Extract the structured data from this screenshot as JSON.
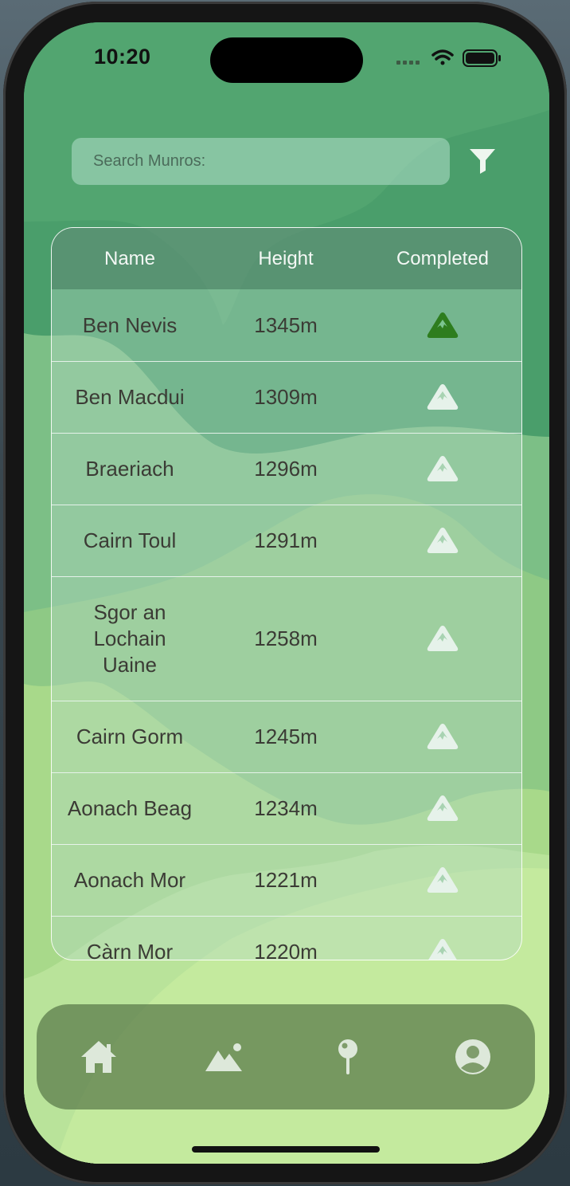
{
  "status_bar": {
    "time": "10:20",
    "signal_icon": "signal-dots-icon",
    "wifi_icon": "wifi-icon",
    "battery_icon": "battery-icon"
  },
  "search": {
    "placeholder": "Search Munros:",
    "value": "",
    "filter_icon": "filter-icon"
  },
  "table": {
    "headers": {
      "name": "Name",
      "height": "Height",
      "completed": "Completed"
    },
    "rows": [
      {
        "name": "Ben Nevis",
        "height": "1345m",
        "completed": true
      },
      {
        "name": "Ben Macdui",
        "height": "1309m",
        "completed": false
      },
      {
        "name": "Braeriach",
        "height": "1296m",
        "completed": false
      },
      {
        "name": "Cairn Toul",
        "height": "1291m",
        "completed": false
      },
      {
        "name": "Sgor an Lochain Uaine",
        "height": "1258m",
        "completed": false
      },
      {
        "name": "Cairn Gorm",
        "height": "1245m",
        "completed": false
      },
      {
        "name": "Aonach Beag",
        "height": "1234m",
        "completed": false
      },
      {
        "name": "Aonach Mor",
        "height": "1221m",
        "completed": false
      },
      {
        "name": "Càrn Mor",
        "height": "1220m",
        "completed": false
      }
    ]
  },
  "nav": [
    {
      "label": "home",
      "icon": "home-icon"
    },
    {
      "label": "mountains",
      "icon": "mountain-icon"
    },
    {
      "label": "map",
      "icon": "map-pin-icon"
    },
    {
      "label": "profile",
      "icon": "profile-icon"
    }
  ],
  "colors": {
    "completed_icon": "#2e7d1e",
    "incomplete_icon": "#e6f2ea",
    "background_top": "#4fa06d",
    "background_bottom": "#c3e79a"
  }
}
